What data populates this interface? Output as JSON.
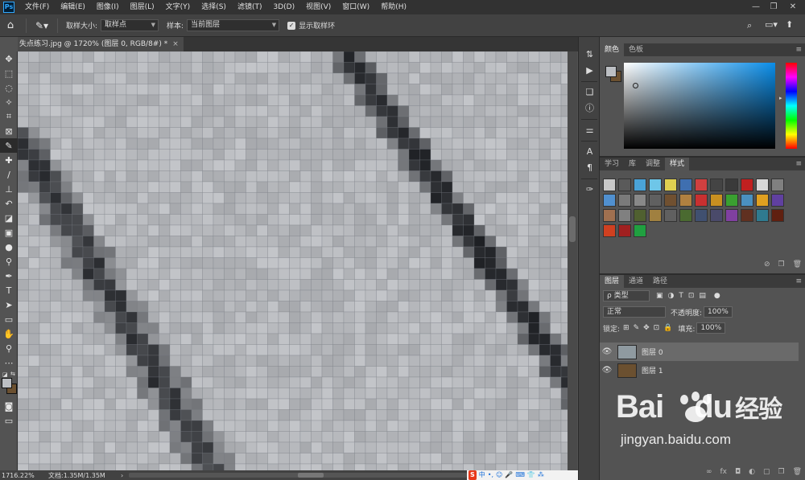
{
  "app": {
    "logo": "Ps"
  },
  "menu": [
    "文件(F)",
    "编辑(E)",
    "图像(I)",
    "图层(L)",
    "文字(Y)",
    "选择(S)",
    "滤镜(T)",
    "3D(D)",
    "视图(V)",
    "窗口(W)",
    "帮助(H)"
  ],
  "window_controls": [
    "—",
    "❐",
    "✕"
  ],
  "options": {
    "sample_size_label": "取样大小:",
    "sample_size_value": "取样点",
    "sample_label": "样本:",
    "sample_value": "当前图层",
    "show_ring_label": "显示取样环",
    "show_ring_checked": true
  },
  "document": {
    "tab_title": "失点练习.jpg @ 1720% (图层 0, RGB/8#) *",
    "close": "×"
  },
  "status": {
    "zoom": "1716.22%",
    "doc_info": "文档:1.35M/1.35M",
    "arrow": "›"
  },
  "ime": {
    "brand": "S",
    "items": [
      "中",
      "•,",
      "☺",
      "🎤",
      "⌨",
      "👕",
      "⁂"
    ]
  },
  "color_panel": {
    "tabs": [
      "颜色",
      "色板"
    ],
    "foreground": "#bcbfc3",
    "background": "#6b5030",
    "hue_color": "#0a8de8"
  },
  "styles_panel": {
    "tabs": [
      "学习",
      "库",
      "调整",
      "样式"
    ],
    "swatches": [
      "#c8c8c8",
      "#5a5a5a",
      "#4aa3d8",
      "#6ec6e8",
      "#e0d050",
      "#3f6fb0",
      "#d04040",
      "#444444",
      "#3a3a3a",
      "#c02020",
      "#d8d8d8",
      "#808080",
      "#5090d0",
      "#7a7a7a",
      "#888888",
      "#606060",
      "#705030",
      "#b08040",
      "#c83030",
      "#c89020",
      "#3aa030",
      "#4a90c0",
      "#e0a020",
      "#6040a0",
      "#a07050",
      "#808080",
      "#506030",
      "#a08040",
      "#606060",
      "#4a6a30",
      "#405070",
      "#4a4a6a",
      "#8040a0",
      "#603020",
      "#2f7a8f",
      "#602010",
      "#d04020",
      "#a02020",
      "#20a040"
    ]
  },
  "layers_panel": {
    "tabs": [
      "图层",
      "通道",
      "路径"
    ],
    "filter_label": "ρ 类型",
    "blend_mode": "正常",
    "opacity_label": "不透明度:",
    "opacity_value": "100%",
    "lock_label": "锁定:",
    "fill_label": "填充:",
    "fill_value": "100%",
    "layers": [
      {
        "name": "图层 0",
        "visible": true,
        "selected": true,
        "thumb_color": "#8f9aa0"
      },
      {
        "name": "图层 1",
        "visible": true,
        "selected": false,
        "thumb_color": "#6b5030"
      }
    ],
    "footer_icons": [
      "∞",
      "fx",
      "◘",
      "◐",
      "▢",
      "❐",
      "🗑"
    ]
  },
  "watermark": {
    "logo_left": "Bai",
    "logo_right": "du",
    "logo_cn": "经验",
    "url": "jingyan.baidu.com"
  }
}
